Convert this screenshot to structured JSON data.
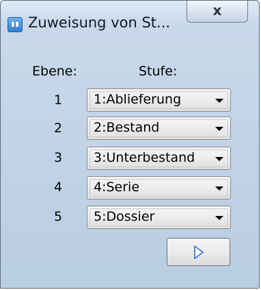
{
  "window": {
    "title": "Zuweisung von St...",
    "close_label": "x"
  },
  "headers": {
    "level": "Ebene:",
    "stage": "Stufe:"
  },
  "rows": [
    {
      "level": "1",
      "stage": "1:Ablieferung"
    },
    {
      "level": "2",
      "stage": "2:Bestand"
    },
    {
      "level": "3",
      "stage": "3:Unterbestand"
    },
    {
      "level": "4",
      "stage": "4:Serie"
    },
    {
      "level": "5",
      "stage": "5:Dossier"
    }
  ],
  "icons": {
    "app": "app-window-icon",
    "next": "play-arrow-icon",
    "dropdown": "chevron-down-icon"
  },
  "colors": {
    "next_arrow": "#2a6fd6"
  }
}
